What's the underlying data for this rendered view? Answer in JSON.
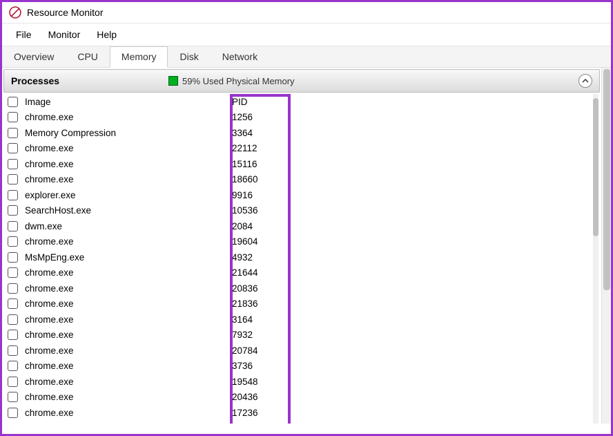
{
  "window": {
    "title": "Resource Monitor"
  },
  "menu": {
    "items": [
      "File",
      "Monitor",
      "Help"
    ]
  },
  "tabs": {
    "items": [
      "Overview",
      "CPU",
      "Memory",
      "Disk",
      "Network"
    ],
    "active": "Memory"
  },
  "section": {
    "title": "Processes",
    "memory_label": "59% Used Physical Memory"
  },
  "columns": {
    "image": "Image",
    "pid": "PID"
  },
  "processes": [
    {
      "image": "chrome.exe",
      "pid": "1256"
    },
    {
      "image": "Memory Compression",
      "pid": "3364"
    },
    {
      "image": "chrome.exe",
      "pid": "22112"
    },
    {
      "image": "chrome.exe",
      "pid": "15116"
    },
    {
      "image": "chrome.exe",
      "pid": "18660"
    },
    {
      "image": "explorer.exe",
      "pid": "9916"
    },
    {
      "image": "SearchHost.exe",
      "pid": "10536"
    },
    {
      "image": "dwm.exe",
      "pid": "2084"
    },
    {
      "image": "chrome.exe",
      "pid": "19604"
    },
    {
      "image": "MsMpEng.exe",
      "pid": "4932"
    },
    {
      "image": "chrome.exe",
      "pid": "21644"
    },
    {
      "image": "chrome.exe",
      "pid": "20836"
    },
    {
      "image": "chrome.exe",
      "pid": "21836"
    },
    {
      "image": "chrome.exe",
      "pid": "3164"
    },
    {
      "image": "chrome.exe",
      "pid": "7932"
    },
    {
      "image": "chrome.exe",
      "pid": "20784"
    },
    {
      "image": "chrome.exe",
      "pid": "3736"
    },
    {
      "image": "chrome.exe",
      "pid": "19548"
    },
    {
      "image": "chrome.exe",
      "pid": "20436"
    },
    {
      "image": "chrome.exe",
      "pid": "17236"
    }
  ]
}
